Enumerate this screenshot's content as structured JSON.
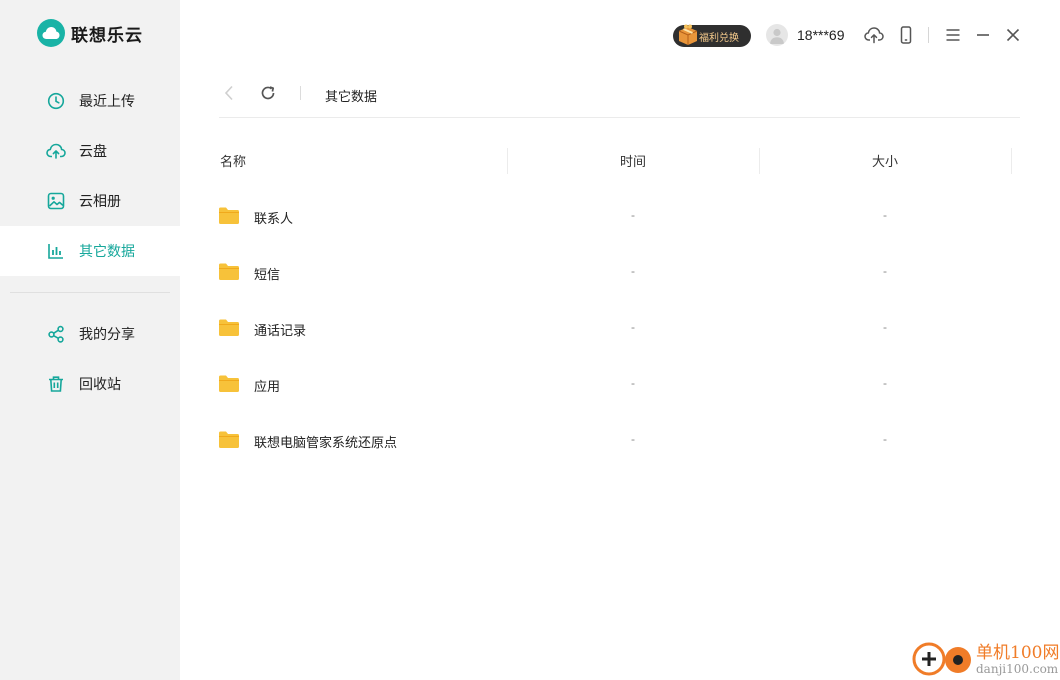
{
  "app": {
    "name": "联想乐云"
  },
  "sidebar": {
    "items": [
      {
        "label": "最近上传",
        "icon": "clock-icon",
        "active": false
      },
      {
        "label": "云盘",
        "icon": "cloud-upload-icon",
        "active": false
      },
      {
        "label": "云相册",
        "icon": "image-icon",
        "active": false
      },
      {
        "label": "其它数据",
        "icon": "bar-chart-icon",
        "active": true
      }
    ],
    "items2": [
      {
        "label": "我的分享",
        "icon": "share-icon"
      },
      {
        "label": "回收站",
        "icon": "trash-icon"
      }
    ]
  },
  "header": {
    "welfare_label": "福利兑换",
    "username": "18***69"
  },
  "toolbar": {
    "breadcrumb": "其它数据"
  },
  "table": {
    "columns": [
      "名称",
      "时间",
      "大小"
    ],
    "rows": [
      {
        "name": "联系人",
        "time": "-",
        "size": "-"
      },
      {
        "name": "短信",
        "time": "-",
        "size": "-"
      },
      {
        "name": "通话记录",
        "time": "-",
        "size": "-"
      },
      {
        "name": "应用",
        "time": "-",
        "size": "-"
      },
      {
        "name": "联想电脑管家系统还原点",
        "time": "-",
        "size": "-"
      }
    ]
  },
  "watermark": {
    "title": "单机100网",
    "url": "danji100.com"
  },
  "colors": {
    "accent": "#16a79b",
    "folder": "#f7c23a",
    "sidebar_bg": "#f2f2f2"
  }
}
